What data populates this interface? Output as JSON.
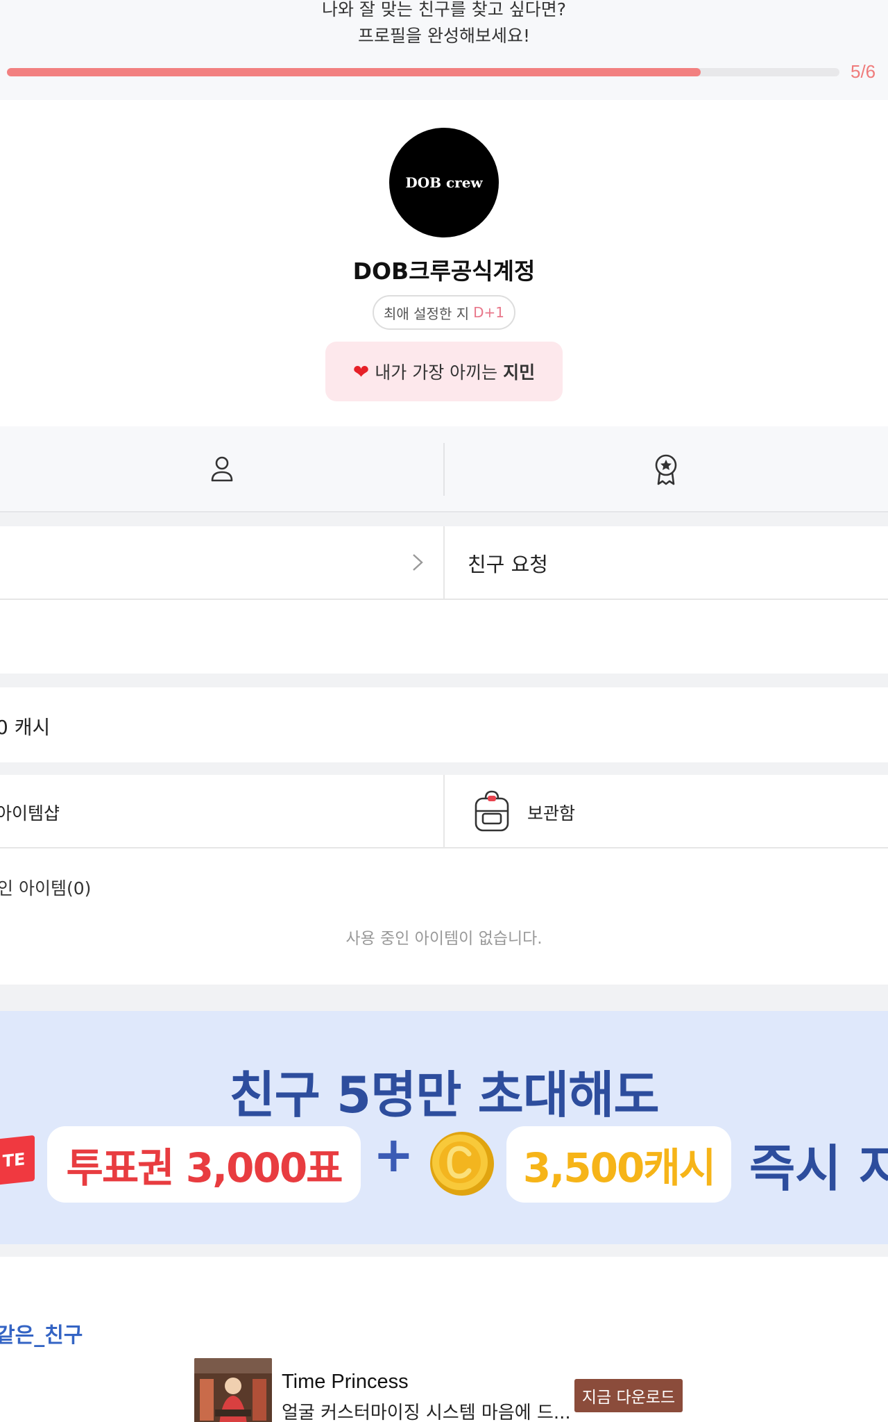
{
  "header": {
    "line1": "나와 잘 맞는 친구를 찾고 싶다면?",
    "line2": "프로필을 완성해보세요!",
    "progress_label": "5/6",
    "progress_fraction": 0.833,
    "accent": "#f28080"
  },
  "profile": {
    "avatar_text": "DOB crew",
    "name": "DOB크루공식계정",
    "dday_label": "최애 설정한 지",
    "dday_value": "D+1",
    "bias_prefix": "내가 가장 아끼는",
    "bias_name": "지민",
    "bias_icon": "heart-icon"
  },
  "tabs": [
    {
      "icon": "person-icon"
    },
    {
      "icon": "award-badge-icon"
    }
  ],
  "friends": {
    "request_label": "친구 요청"
  },
  "cash": {
    "label": "0 캐시"
  },
  "items": {
    "shop_label": "아이템샵",
    "storage_label": "보관함",
    "in_use_label": "인 아이템(0)",
    "empty_text": "사용 중인 아이템이 없습니다."
  },
  "banner": {
    "headline": "친구 5명만 초대해도",
    "vote_tag": "TE",
    "vote_pill": "투표권 3,000표",
    "plus": "+",
    "cash_pill": "3,500캐시",
    "tail": "즉시 지"
  },
  "bottom": {
    "hashtag": "같은_친구",
    "ad_title": "Time Princess",
    "ad_desc": "얼굴 커스터마이징 시스템 마음에 드...",
    "ad_button": "지금 다운로드"
  }
}
